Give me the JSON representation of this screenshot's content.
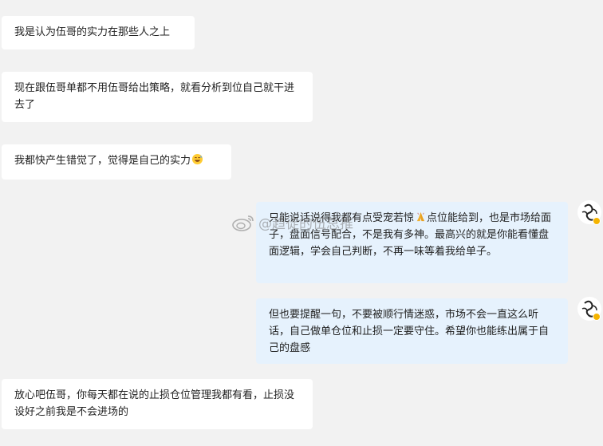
{
  "messages": [
    {
      "side": "left",
      "text": "我是认为伍哥的实力在那些人之上"
    },
    {
      "side": "left",
      "text": "现在跟伍哥单都不用伍哥给出策略，就看分析到位自己就干进去了"
    },
    {
      "side": "left",
      "text": "我都快产生错觉了，觉得是自己的实力",
      "emoji": "grinning-sweat-emoji"
    },
    {
      "side": "right",
      "text_before": "只能说话说得我都有点受宠若惊",
      "emoji": "folded-hands-emoji",
      "text_after": "点位能给到，也是市场给面子，盘面信号配合，不是我有多神。最高兴的就是你能看懂盘面逻辑，学会自己判断，不再一味等着我给单子。"
    },
    {
      "side": "right",
      "text": "但也要提醒一句，不要被顺行情迷惑，市场不会一直这么听话，自己做单仓位和止损一定要守住。希望你也能练出属于自己的盘感"
    },
    {
      "side": "left",
      "text": "放心吧伍哥，你每天都在说的止损仓位管理我都有看，止损没设好之前我是不会进场的"
    }
  ],
  "watermark": {
    "text": "@趋徒的伍总推",
    "icon": "weibo-logo"
  },
  "colors": {
    "background": "#f2f2f2",
    "left_bubble": "#ffffff",
    "right_bubble": "#e6f2fd",
    "verified": "#f5b400"
  }
}
